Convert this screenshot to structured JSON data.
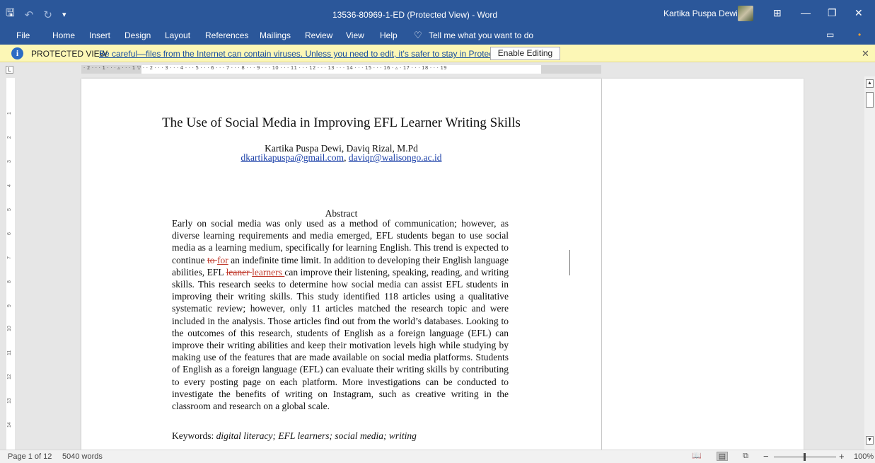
{
  "window": {
    "doc_title": "13536-80969-1-ED (Protected View)  -  Word",
    "user_name": "Kartika Puspa Dewi"
  },
  "ribbon": {
    "tabs": [
      "File",
      "Home",
      "Insert",
      "Design",
      "Layout",
      "References",
      "Mailings",
      "Review",
      "View",
      "Help"
    ],
    "tell_me": "Tell me what you want to do"
  },
  "protected_view": {
    "label": "PROTECTED VIEW",
    "message": "Be careful—files from the Internet can contain viruses. Unless you need to edit, it's safer to stay in Protected View.",
    "enable_button": "Enable Editing"
  },
  "ruler": {
    "ticks": "· 2 · · · 1 · · · ▵ · · · 1 ▽ · · 2 · · · 3 · · · 4 · · · 5 · · · 6 · · · 7 · · · 8 · · · 9 · · · 10 · · · 11 · · · 12 · · · 13 · · · 14 · · · 15 · · · 16 · ▵ · 17 · · · 18 · · · 19",
    "vertical_ticks": [
      "1",
      "2",
      "3",
      "4",
      "5",
      "6",
      "7",
      "8",
      "9",
      "10",
      "11",
      "12",
      "13",
      "14"
    ]
  },
  "document": {
    "title": "The Use of Social Media in Improving EFL Learner Writing Skills",
    "authors": "Kartika Puspa Dewi, Daviq Rizal, M.Pd",
    "email1": "dkartikapuspa@gmail.com",
    "email_sep": ", ",
    "email2": "daviqr@walisongo.ac.id",
    "abstract_heading": "Abstract",
    "abstract_p1": "Early on social media was only used as a method of communication; however, as diverse learning requirements and media emerged, EFL students began to use social media as a learning medium, specifically for learning English. This trend is expected to continue ",
    "del1": "to ",
    "ins1": "for",
    "abstract_p2": " an indefinite time limit. In addition to developing their English language abilities, EFL ",
    "del2": "leaner ",
    "ins2": "learners ",
    "abstract_p3": "can improve their listening, speaking, reading, and writing skills. This research seeks to determine how social media can assist EFL students in improving their writing skills. This study identified 118 articles using a qualitative systematic review; however, only 11 articles matched the research topic and were included in the analysis. Those articles find out from the world’s databases. Looking to the outcomes of this research, students of English as a foreign language (EFL) can improve their writing abilities and keep their motivation levels high while studying by making use of the features that are made available on social media platforms. Students of English as a foreign language (EFL) can evaluate their writing skills by contributing to every posting page on each platform. More investigations can be conducted to investigate the benefits of writing on Instagram, such as creative writing in the classroom and research on a global scale.",
    "keywords_label": "Keywords: ",
    "keywords": "digital literacy; EFL learners; social media; writing"
  },
  "statusbar": {
    "page": "Page 1 of 12",
    "words": "5040 words",
    "zoom": "100%",
    "zoom_fraction": 0.5
  },
  "icons": {
    "save": "save-icon",
    "undo": "undo-icon",
    "redo": "redo-icon",
    "info": "info-icon",
    "lightbulb": "lightbulb-icon"
  },
  "colors": {
    "ribbon": "#2b579a",
    "protected_bar": "#fcf7b6",
    "link": "#1a3fa8",
    "revision": "#c0392b"
  }
}
